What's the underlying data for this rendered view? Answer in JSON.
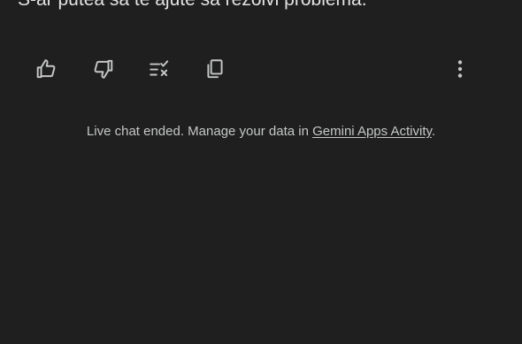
{
  "message": {
    "visible_tail": "S-ar putea să te ajute să rezolvi problema."
  },
  "actions": {
    "like_icon": "thumb-up-icon",
    "dislike_icon": "thumb-down-icon",
    "modify_icon": "modify-response-icon",
    "copy_icon": "copy-icon",
    "more_icon": "more-vert-icon"
  },
  "footer": {
    "prefix": "Live chat ended. Manage your data in ",
    "link_text": "Gemini Apps Activity",
    "suffix": "."
  },
  "colors": {
    "background": "#1f1f1f",
    "text": "#e3e3e3",
    "muted_text": "#c4c7c5"
  }
}
